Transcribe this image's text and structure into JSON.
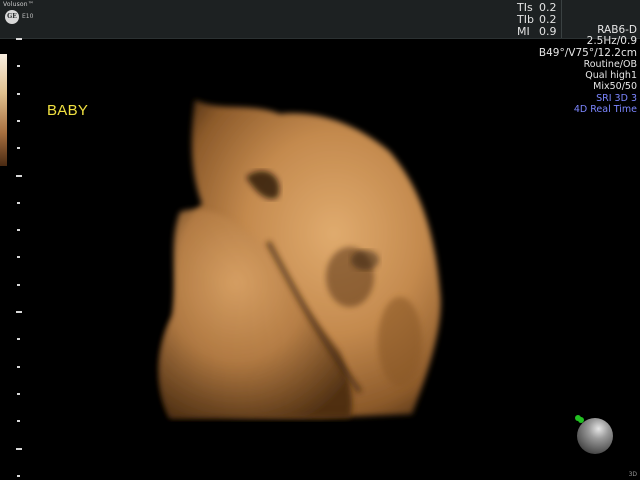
{
  "header": {
    "brand_name": "Voluson™",
    "brand_logo": "GE",
    "brand_model": "E10",
    "indices": [
      {
        "label": "TIs",
        "value": "0.2"
      },
      {
        "label": "TIb",
        "value": "0.2"
      },
      {
        "label": "MI",
        "value": "0.9"
      }
    ]
  },
  "image_label": "BABY",
  "parameters": [
    {
      "text": "RAB6-D",
      "style": "big"
    },
    {
      "text": "2.5Hz/0.9",
      "style": "big"
    },
    {
      "text": "B49°/V75°/12.2cm",
      "style": "big"
    },
    {
      "text": "Routine/OB",
      "style": "normal"
    },
    {
      "text": "Qual high1",
      "style": "normal"
    },
    {
      "text": "Mix50/50",
      "style": "normal"
    },
    {
      "text": "SRI 3D 3",
      "style": "blue"
    },
    {
      "text": "4D Real Time",
      "style": "blue"
    }
  ],
  "corner_tag": "3D",
  "colors": {
    "label": "#f0e040",
    "mode_text": "#7c86ff",
    "render_tone": "#c48a4e",
    "orientation_marker": "#22c022"
  },
  "icons": {
    "orientation": "orientation-ball-icon",
    "marker": "orientation-marker-icon"
  }
}
